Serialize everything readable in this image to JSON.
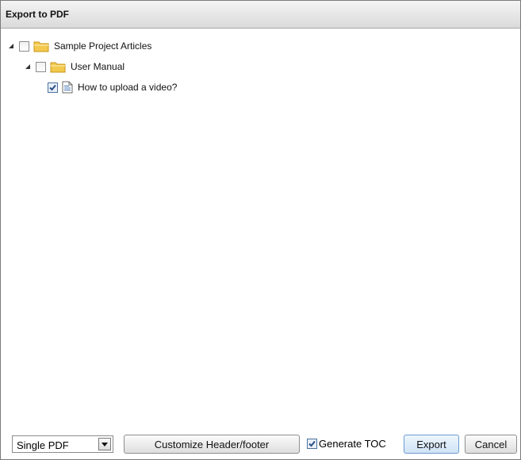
{
  "window": {
    "title": "Export to PDF"
  },
  "tree": {
    "nodes": [
      {
        "label": "Sample Project Articles",
        "type": "folder",
        "expanded": true,
        "checked": false
      },
      {
        "label": "User Manual",
        "type": "folder",
        "expanded": true,
        "checked": false
      },
      {
        "label": "How to upload a video?",
        "type": "document",
        "checked": true
      }
    ]
  },
  "footer": {
    "format_select": {
      "value": "Single PDF"
    },
    "customize_label": "Customize Header/footer",
    "toc": {
      "label": "Generate TOC",
      "checked": true
    },
    "export_label": "Export",
    "cancel_label": "Cancel"
  },
  "colors": {
    "folder": "#f2c94c",
    "folder_dark": "#d9a520",
    "check": "#2a4f86",
    "export_border": "#6d9ccf"
  },
  "icons": {
    "expander": "triangle-expanded-icon",
    "folder": "folder-icon",
    "document": "document-icon",
    "dropdown": "chevron-down-icon"
  }
}
